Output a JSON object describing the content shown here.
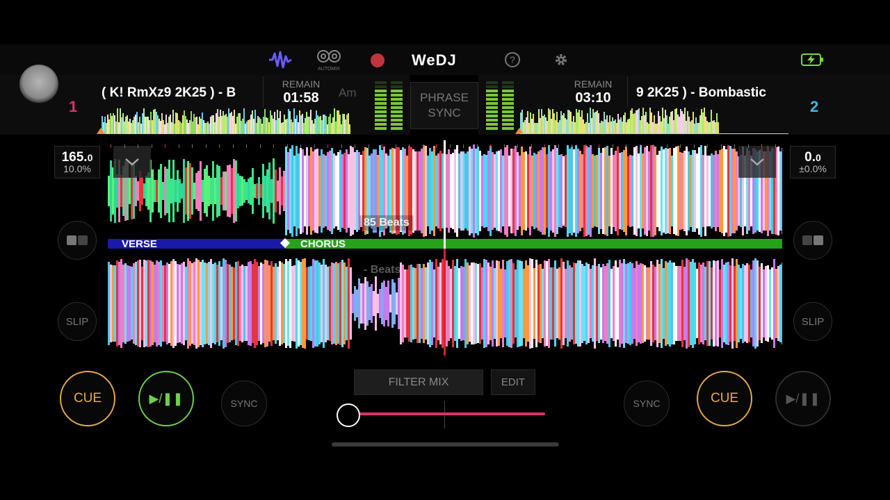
{
  "app": {
    "title": "WeDJ"
  },
  "toolbar": {
    "automix_label": "AUTOMIX",
    "colors": {
      "waveform_icon": "#6a5cff",
      "record": "#c0353d",
      "battery": "#7cd64a"
    }
  },
  "deck1": {
    "number": "1",
    "number_color": "#e0306b",
    "track_title": "( K! RmXz9 2K25 ) - B",
    "remain_label": "REMAIN",
    "remain_time": "01:58",
    "key": "Am",
    "bpm": "165.",
    "bpm_decimal": "0",
    "pitch": "10.0%",
    "phrases": [
      {
        "label": "VERSE",
        "color": "#1a1aa8"
      },
      {
        "label": "CHORUS",
        "color": "#25a21a"
      }
    ],
    "beats_label": "85 Beats",
    "slip_label": "SLIP",
    "cue_label": "CUE",
    "sync_label": "SYNC",
    "play_glyph": "▶/❚❚"
  },
  "deck2": {
    "number": "2",
    "number_color": "#3fb6e8",
    "track_title": "9 2K25 ) - Bombastic",
    "remain_label": "REMAIN",
    "remain_time": "03:10",
    "bpm": "0.",
    "bpm_decimal": "0",
    "pitch": "±0.0%",
    "beats_label": "- Beats",
    "slip_label": "SLIP",
    "cue_label": "CUE",
    "sync_label": "SYNC",
    "play_glyph": "▶/❚❚"
  },
  "center": {
    "phrase_sync_line1": "PHRASE",
    "phrase_sync_line2": "SYNC",
    "filter_mix_label": "FILTER MIX",
    "edit_label": "EDIT",
    "crossfader_position": 0
  },
  "icons": {
    "waveform": "waveform-icon",
    "automix": "automix-icon",
    "record": "record-icon",
    "help": "help-icon",
    "settings": "gear-icon",
    "battery": "battery-charging-icon",
    "chevron": "chevron-down-icon",
    "loop_toggle": "loop-toggle-icon"
  }
}
